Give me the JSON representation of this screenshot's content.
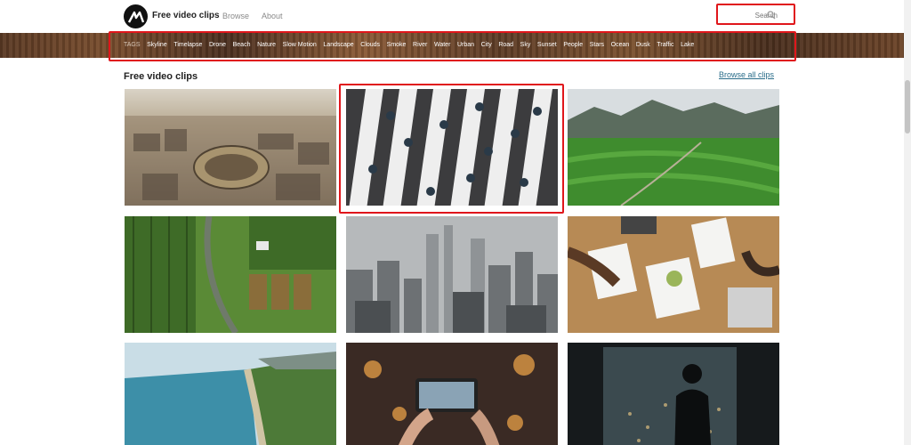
{
  "header": {
    "brand": "Free video clips",
    "nav": [
      "Browse",
      "About"
    ],
    "search_placeholder": "Search"
  },
  "tags": {
    "label": "TAGS",
    "items": [
      "Skyline",
      "Timelapse",
      "Drone",
      "Beach",
      "Nature",
      "Slow Motion",
      "Landscape",
      "Clouds",
      "Smoke",
      "River",
      "Water",
      "Urban",
      "City",
      "Road",
      "Sky",
      "Sunset",
      "People",
      "Stars",
      "Ocean",
      "Dusk",
      "Traffic",
      "Lake"
    ]
  },
  "section": {
    "title": "Free video clips",
    "browse_all": "Browse all clips"
  },
  "clips": [
    {
      "subject": "aerial-rome-colosseum"
    },
    {
      "subject": "crosswalk-people-aerial"
    },
    {
      "subject": "green-rice-fields-mountains"
    },
    {
      "subject": "aerial-farm-fields-road"
    },
    {
      "subject": "hazy-city-skyline"
    },
    {
      "subject": "business-meeting-table"
    },
    {
      "subject": "coastline-beach-aerial"
    },
    {
      "subject": "phone-filming-night-street"
    },
    {
      "subject": "silhouette-window-night-city"
    }
  ],
  "icons": {
    "logo": "mixkit-logo-icon",
    "search": "search-icon"
  },
  "colors": {
    "accent_link": "#2a6d8a",
    "annotation": "#e0161b"
  }
}
